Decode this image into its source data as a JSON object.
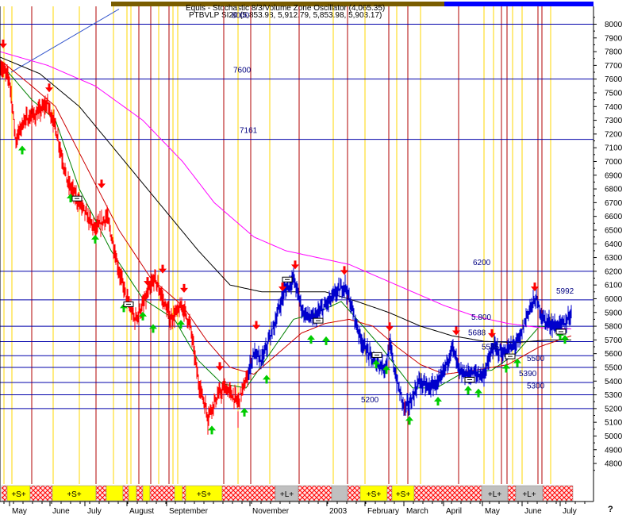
{
  "header": {
    "title_line1": "Equis - Stochastic 8/3/Volume Zone Oscillator (4,065.35)",
    "title_line2": "PTBVLP SI20 (5,853.98, 5,912.79, 5,853.98, 5,903.17)"
  },
  "chart_data": {
    "type": "line",
    "title": "",
    "xlabel": "",
    "ylabel": "",
    "ylim": [
      4650,
      8130
    ],
    "yticks": [
      4800,
      4900,
      5000,
      5100,
      5200,
      5300,
      5400,
      5500,
      5600,
      5700,
      5800,
      5900,
      6000,
      6100,
      6200,
      6300,
      6400,
      6500,
      6600,
      6700,
      6800,
      6900,
      7000,
      7100,
      7200,
      7300,
      7400,
      7500,
      7600,
      7700,
      7800,
      7900,
      8000
    ],
    "xlim": [
      0,
      750
    ],
    "months": [
      {
        "label": "May",
        "x": 15
      },
      {
        "label": "June",
        "x": 66
      },
      {
        "label": "July",
        "x": 110
      },
      {
        "label": "August",
        "x": 163
      },
      {
        "label": "September",
        "x": 213
      },
      {
        "label": "November",
        "x": 318
      },
      {
        "label": "2003",
        "x": 415
      },
      {
        "label": "February",
        "x": 463
      },
      {
        "label": "March",
        "x": 512
      },
      {
        "label": "April",
        "x": 562
      },
      {
        "label": "May",
        "x": 611
      },
      {
        "label": "June",
        "x": 661
      },
      {
        "label": "July",
        "x": 709
      }
    ],
    "level_lines": [
      {
        "label": "8000",
        "value": 8000,
        "label_x": 292
      },
      {
        "label": "7600",
        "value": 7600,
        "label_x": 294
      },
      {
        "label": "7161",
        "value": 7161,
        "label_x": 302
      },
      {
        "label": "6200",
        "value": 6200,
        "label_x": 596
      },
      {
        "label": "5992",
        "value": 5992,
        "label_x": 701
      },
      {
        "label": "5.800",
        "value": 5800,
        "label_x": 594
      },
      {
        "label": "5688",
        "value": 5688,
        "label_x": 590
      },
      {
        "label": "5585",
        "value": 5585,
        "label_x": 607
      },
      {
        "label": "5500",
        "value": 5500,
        "label_x": 664
      },
      {
        "label": "5390",
        "value": 5390,
        "label_x": 654
      },
      {
        "label": "5300",
        "value": 5300,
        "label_x": 664
      },
      {
        "label": "5200",
        "value": 5200,
        "label_x": 455
      }
    ],
    "price_series": {
      "name": "PTBVLP SI20",
      "keypoints": [
        [
          0,
          7700
        ],
        [
          12,
          7600
        ],
        [
          20,
          7150
        ],
        [
          30,
          7300
        ],
        [
          45,
          7340
        ],
        [
          60,
          7420
        ],
        [
          70,
          7250
        ],
        [
          85,
          6850
        ],
        [
          100,
          6700
        ],
        [
          120,
          6500
        ],
        [
          135,
          6600
        ],
        [
          150,
          6200
        ],
        [
          160,
          6000
        ],
        [
          170,
          5850
        ],
        [
          180,
          5950
        ],
        [
          195,
          6150
        ],
        [
          205,
          6000
        ],
        [
          215,
          5850
        ],
        [
          230,
          5950
        ],
        [
          240,
          5800
        ],
        [
          250,
          5400
        ],
        [
          262,
          5150
        ],
        [
          275,
          5300
        ],
        [
          285,
          5350
        ],
        [
          300,
          5250
        ],
        [
          310,
          5400
        ],
        [
          320,
          5600
        ],
        [
          330,
          5550
        ],
        [
          345,
          5800
        ],
        [
          358,
          6050
        ],
        [
          370,
          6150
        ],
        [
          382,
          5900
        ],
        [
          395,
          5850
        ],
        [
          410,
          5950
        ],
        [
          425,
          6050
        ],
        [
          435,
          6100
        ],
        [
          445,
          5900
        ],
        [
          455,
          5700
        ],
        [
          470,
          5550
        ],
        [
          485,
          5500
        ],
        [
          492,
          5650
        ],
        [
          500,
          5400
        ],
        [
          510,
          5200
        ],
        [
          518,
          5250
        ],
        [
          528,
          5400
        ],
        [
          540,
          5350
        ],
        [
          555,
          5400
        ],
        [
          570,
          5650
        ],
        [
          580,
          5450
        ],
        [
          595,
          5450
        ],
        [
          610,
          5450
        ],
        [
          622,
          5650
        ],
        [
          635,
          5600
        ],
        [
          645,
          5650
        ],
        [
          655,
          5700
        ],
        [
          665,
          5900
        ],
        [
          675,
          6000
        ],
        [
          685,
          5850
        ],
        [
          700,
          5800
        ],
        [
          712,
          5820
        ],
        [
          720,
          5900
        ]
      ],
      "red_start_x": 0,
      "red_end_x": 312,
      "blue_end_x": 720
    },
    "moving_averages": [
      {
        "color": "#008000",
        "keypoints": [
          [
            0,
            7720
          ],
          [
            40,
            7450
          ],
          [
            70,
            7300
          ],
          [
            100,
            6800
          ],
          [
            140,
            6350
          ],
          [
            180,
            6000
          ],
          [
            220,
            5850
          ],
          [
            250,
            5550
          ],
          [
            280,
            5380
          ],
          [
            310,
            5350
          ],
          [
            340,
            5600
          ],
          [
            370,
            5850
          ],
          [
            400,
            5900
          ],
          [
            430,
            5980
          ],
          [
            450,
            5850
          ],
          [
            480,
            5650
          ],
          [
            500,
            5500
          ],
          [
            520,
            5350
          ],
          [
            550,
            5350
          ],
          [
            580,
            5450
          ],
          [
            620,
            5480
          ],
          [
            650,
            5600
          ],
          [
            680,
            5800
          ],
          [
            720,
            5780
          ]
        ]
      },
      {
        "color": "#cc0000",
        "keypoints": [
          [
            0,
            7740
          ],
          [
            40,
            7550
          ],
          [
            70,
            7400
          ],
          [
            110,
            6950
          ],
          [
            150,
            6500
          ],
          [
            190,
            6150
          ],
          [
            230,
            5950
          ],
          [
            260,
            5700
          ],
          [
            290,
            5500
          ],
          [
            320,
            5450
          ],
          [
            350,
            5600
          ],
          [
            380,
            5750
          ],
          [
            410,
            5820
          ],
          [
            440,
            5850
          ],
          [
            470,
            5800
          ],
          [
            500,
            5650
          ],
          [
            530,
            5520
          ],
          [
            560,
            5450
          ],
          [
            600,
            5480
          ],
          [
            640,
            5520
          ],
          [
            680,
            5650
          ],
          [
            720,
            5730
          ]
        ]
      },
      {
        "color": "#000000",
        "keypoints": [
          [
            0,
            7760
          ],
          [
            50,
            7640
          ],
          [
            100,
            7400
          ],
          [
            150,
            7050
          ],
          [
            200,
            6700
          ],
          [
            250,
            6350
          ],
          [
            290,
            6100
          ],
          [
            330,
            6050
          ],
          [
            370,
            6050
          ],
          [
            410,
            6050
          ],
          [
            450,
            5980
          ],
          [
            490,
            5900
          ],
          [
            530,
            5800
          ],
          [
            570,
            5730
          ],
          [
            610,
            5690
          ],
          [
            650,
            5680
          ],
          [
            690,
            5700
          ],
          [
            720,
            5700
          ]
        ]
      },
      {
        "color": "#ff00ff",
        "keypoints": [
          [
            0,
            7800
          ],
          [
            60,
            7700
          ],
          [
            120,
            7550
          ],
          [
            180,
            7300
          ],
          [
            230,
            7000
          ],
          [
            270,
            6700
          ],
          [
            320,
            6450
          ],
          [
            360,
            6350
          ],
          [
            400,
            6300
          ],
          [
            440,
            6250
          ],
          [
            480,
            6150
          ],
          [
            520,
            6050
          ],
          [
            560,
            5950
          ],
          [
            600,
            5870
          ],
          [
            640,
            5820
          ],
          [
            680,
            5790
          ],
          [
            720,
            5780
          ]
        ]
      }
    ],
    "signals": {
      "sell_arrows": [
        [
          4,
          7830
        ],
        [
          62,
          7510
        ],
        [
          128,
          6810
        ],
        [
          186,
          6100
        ],
        [
          205,
          6190
        ],
        [
          232,
          6050
        ],
        [
          277,
          5480
        ],
        [
          323,
          5780
        ],
        [
          356,
          6060
        ],
        [
          372,
          6220
        ],
        [
          434,
          6180
        ],
        [
          491,
          5770
        ],
        [
          575,
          5740
        ],
        [
          620,
          5720
        ],
        [
          674,
          6060
        ]
      ],
      "buy_arrows": [
        [
          28,
          7110
        ],
        [
          89,
          6760
        ],
        [
          120,
          6460
        ],
        [
          156,
          5960
        ],
        [
          180,
          5900
        ],
        [
          193,
          5810
        ],
        [
          228,
          5840
        ],
        [
          267,
          5070
        ],
        [
          308,
          5200
        ],
        [
          336,
          5440
        ],
        [
          392,
          5730
        ],
        [
          411,
          5720
        ],
        [
          474,
          5550
        ],
        [
          487,
          5510
        ],
        [
          516,
          5140
        ],
        [
          552,
          5280
        ],
        [
          590,
          5360
        ],
        [
          603,
          5340
        ],
        [
          638,
          5520
        ],
        [
          652,
          5560
        ],
        [
          706,
          5760
        ],
        [
          712,
          5730
        ]
      ],
      "buy_exit_markers": [
        [
          97,
          6730
        ],
        [
          162,
          5960
        ],
        [
          362,
          6140
        ],
        [
          401,
          5840
        ],
        [
          475,
          5590
        ],
        [
          592,
          5410
        ],
        [
          643,
          5580
        ],
        [
          707,
          5760
        ]
      ]
    },
    "vertical_lines": {
      "red": [
        40,
        121,
        175,
        190,
        213,
        282,
        316,
        377,
        438,
        490,
        514,
        578,
        632,
        639,
        678,
        683
      ],
      "yellow": [
        5,
        15,
        67,
        100,
        143,
        160,
        165,
        175,
        200,
        218,
        224,
        300,
        340,
        420,
        460,
        500,
        530,
        610,
        622,
        646,
        658,
        694
      ]
    },
    "bottom_band": [
      {
        "x1": 2,
        "x2": 9,
        "type": "hatch"
      },
      {
        "x1": 9,
        "x2": 38,
        "type": "yellow",
        "label": "+S+"
      },
      {
        "x1": 38,
        "x2": 66,
        "type": "hatch"
      },
      {
        "x1": 66,
        "x2": 121,
        "type": "yellow",
        "label": "+S+"
      },
      {
        "x1": 121,
        "x2": 134,
        "type": "hatch"
      },
      {
        "x1": 134,
        "x2": 155,
        "type": "yellow"
      },
      {
        "x1": 155,
        "x2": 162,
        "type": "hatch"
      },
      {
        "x1": 162,
        "x2": 172,
        "type": "yellow"
      },
      {
        "x1": 172,
        "x2": 180,
        "type": "hatch"
      },
      {
        "x1": 180,
        "x2": 189,
        "type": "yellow"
      },
      {
        "x1": 189,
        "x2": 220,
        "type": "hatch"
      },
      {
        "x1": 220,
        "x2": 230,
        "type": "yellow"
      },
      {
        "x1": 230,
        "x2": 234,
        "type": "hatch"
      },
      {
        "x1": 234,
        "x2": 280,
        "type": "yellow",
        "label": "+S+"
      },
      {
        "x1": 280,
        "x2": 347,
        "type": "hatch"
      },
      {
        "x1": 347,
        "x2": 376,
        "type": "gray",
        "label": "+L+"
      },
      {
        "x1": 376,
        "x2": 418,
        "type": "hatch"
      },
      {
        "x1": 418,
        "x2": 438,
        "type": "gray"
      },
      {
        "x1": 438,
        "x2": 454,
        "type": "hatch"
      },
      {
        "x1": 454,
        "x2": 488,
        "type": "yellow",
        "label": "+S+"
      },
      {
        "x1": 488,
        "x2": 494,
        "type": "hatch"
      },
      {
        "x1": 494,
        "x2": 522,
        "type": "yellow",
        "label": "+S+"
      },
      {
        "x1": 522,
        "x2": 607,
        "type": "hatch"
      },
      {
        "x1": 607,
        "x2": 640,
        "type": "gray",
        "label": "+L+"
      },
      {
        "x1": 640,
        "x2": 650,
        "type": "hatch"
      },
      {
        "x1": 650,
        "x2": 684,
        "type": "gray",
        "label": "+L+"
      },
      {
        "x1": 684,
        "x2": 722,
        "type": "hatch"
      }
    ],
    "corner_mark": "?"
  },
  "colors": {
    "price_down": "#ff0000",
    "price_up": "#0000cc",
    "level_line": "#0000aa",
    "level_label": "#000080",
    "sell_arrow": "#ff0000",
    "buy_arrow": "#00cc00",
    "vline_red": "#b00000",
    "vline_yellow": "#ffd700",
    "band_yellow": "#ffff00",
    "band_gray": "#c0c0c0",
    "band_hatch": "#ff0000"
  }
}
